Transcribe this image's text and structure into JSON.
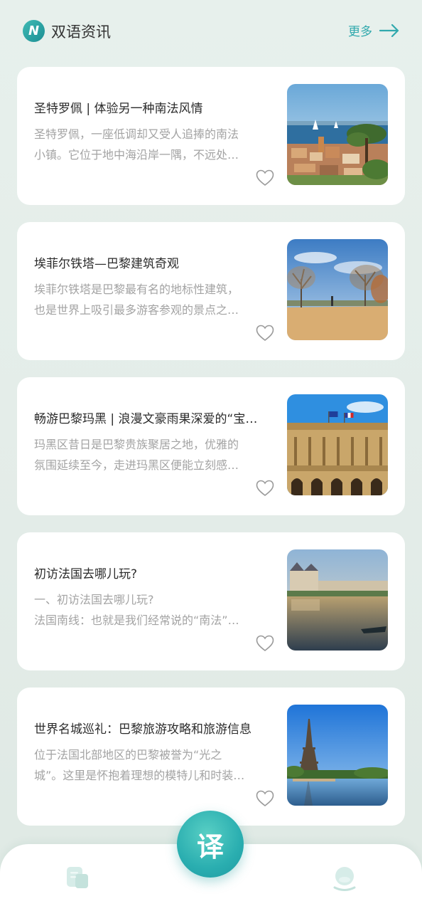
{
  "header": {
    "title": "双语资讯",
    "more_label": "更多",
    "logo_icon": "n-logo-icon"
  },
  "articles": [
    {
      "title": "圣特罗佩 | 体验另一种南法风情",
      "desc_line1": "圣特罗佩，一座低调却又受人追捧的南法",
      "desc_line2": "小镇。它位于地中海沿岸一隅，不远处…",
      "image": "seaside-town-photo"
    },
    {
      "title": "埃菲尔铁塔—巴黎建筑奇观",
      "desc_line1": "埃菲尔铁塔是巴黎最有名的地标性建筑，",
      "desc_line2": "也是世界上吸引最多游客参观的景点之…",
      "image": "park-avenue-photo"
    },
    {
      "title": "畅游巴黎玛黑 | 浪漫文豪雨果深爱的“宝…",
      "desc_line1": "玛黑区昔日是巴黎贵族聚居之地，优雅的",
      "desc_line2": "氛围延续至今，走进玛黑区便能立刻感…",
      "image": "opera-building-photo"
    },
    {
      "title": "初访法国去哪儿玩?",
      "desc_line1": "一、初访法国去哪儿玩?",
      "desc_line2": "法国南线：也就是我们经常说的“南法”…",
      "image": "chateau-river-photo"
    },
    {
      "title": "世界名城巡礼：巴黎旅游攻略和旅游信息",
      "desc_line1": "位于法国北部地区的巴黎被誉为“光之",
      "desc_line2": "城”。这里是怀抱着理想的模特儿和时装…",
      "image": "eiffel-tower-photo"
    }
  ],
  "bottom_nav": {
    "translate_label": "译",
    "left_icon": "news-icon",
    "right_icon": "profile-icon"
  },
  "colors": {
    "accent": "#31a9ad",
    "background": "#e6efeb",
    "card": "#ffffff",
    "title_text": "#2b2b2b",
    "desc_text": "#a3a3a3"
  }
}
